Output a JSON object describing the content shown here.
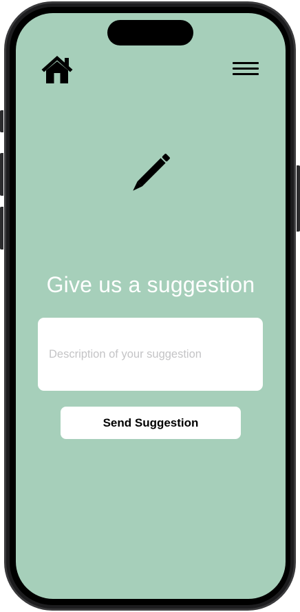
{
  "colors": {
    "screen_background": "#a6cfba",
    "title_text": "#ffffff",
    "field_background": "#ffffff",
    "placeholder_text": "#c4c4c6",
    "button_background": "#ffffff",
    "button_text": "#000000"
  },
  "header": {
    "home_icon": "house-icon",
    "menu_icon": "hamburger-menu-icon"
  },
  "hero": {
    "icon": "pencil-icon"
  },
  "form": {
    "title": "Give us a suggestion",
    "description_value": "",
    "description_placeholder": "Description of your suggestion",
    "submit_label": "Send Suggestion"
  }
}
